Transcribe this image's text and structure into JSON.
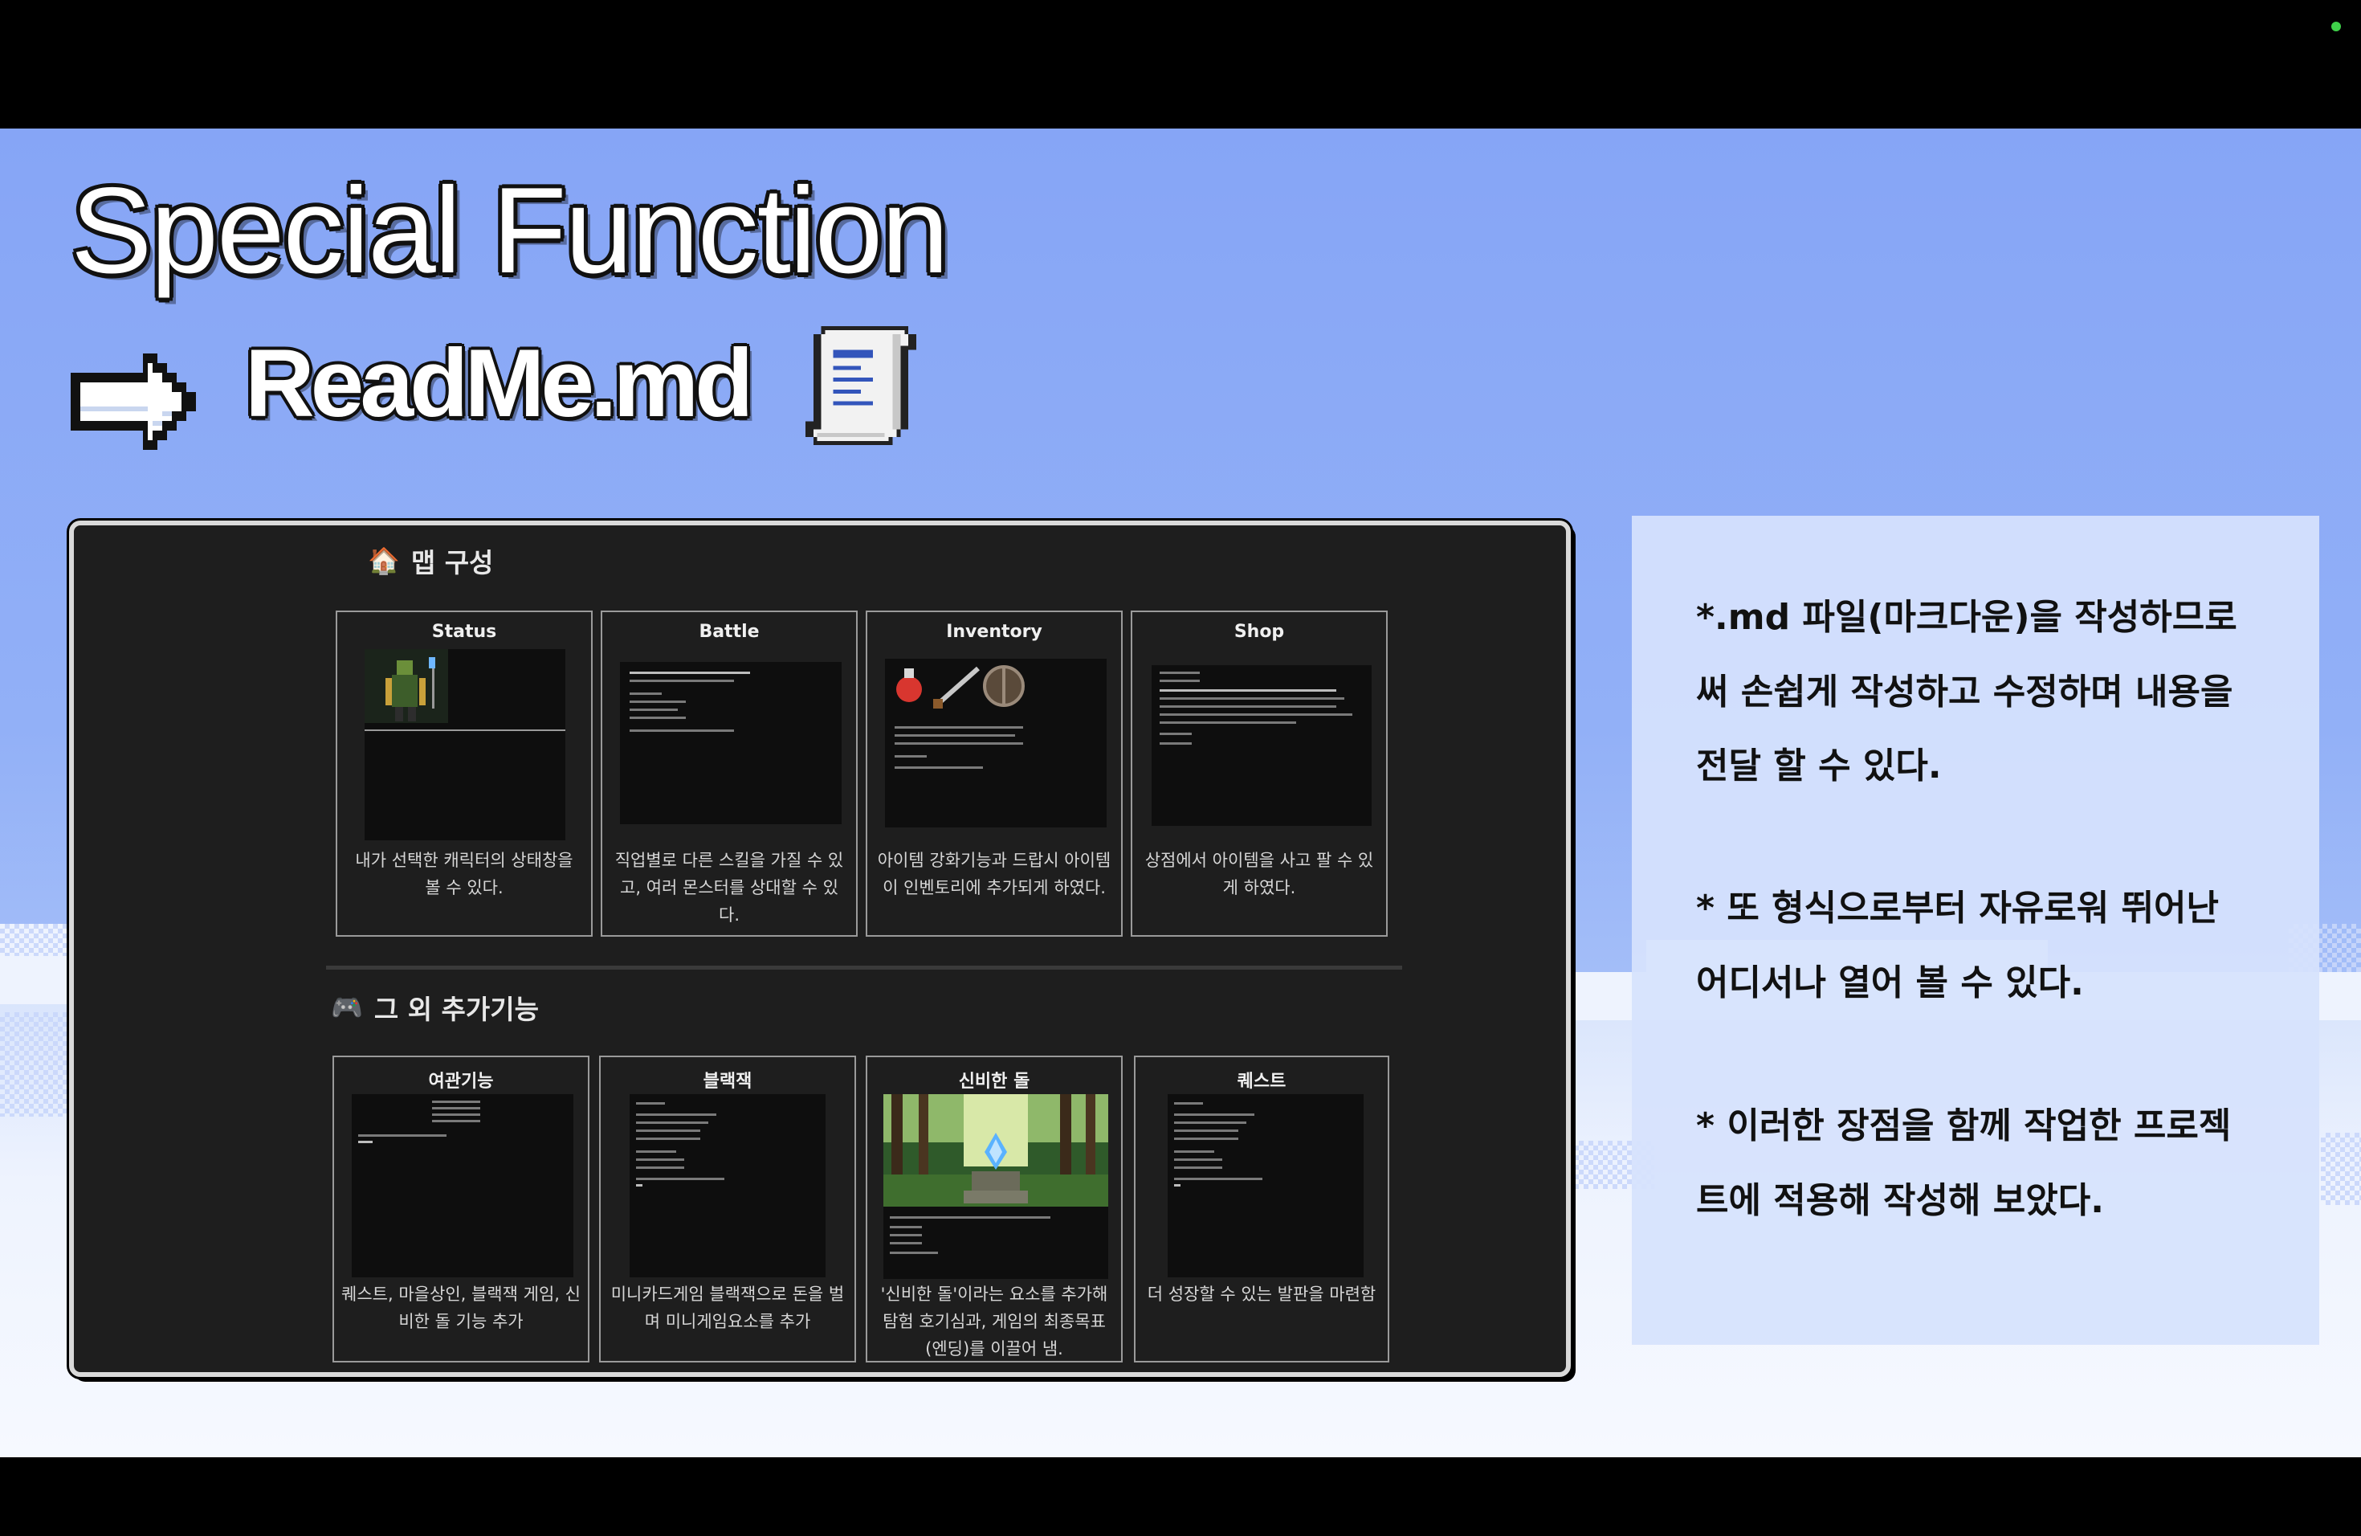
{
  "slide": {
    "title": "Special Function",
    "subtitle": "ReadMe.md",
    "icons": {
      "arrow": "pixel-arrow-right-icon",
      "document": "scroll-document-icon"
    }
  },
  "map_section": {
    "heading": "맵 구성",
    "icon": "house-emoji-icon",
    "cards": [
      {
        "title": "Status",
        "desc_lines": [
          "내가 선택한 캐릭터의 상태창을",
          "볼 수 있다."
        ]
      },
      {
        "title": "Battle",
        "desc_lines": [
          "직업별로 다른 스킬을 가질 수 있",
          "고, 여러 몬스터를 상대할 수 있",
          "다."
        ]
      },
      {
        "title": "Inventory",
        "desc_lines": [
          "아이템 강화기능과 드랍시 아이템",
          "이 인벤토리에 추가되게 하였다."
        ]
      },
      {
        "title": "Shop",
        "desc_lines": [
          "상점에서 아이템을 사고 팔 수 있",
          "게 하였다."
        ]
      }
    ]
  },
  "extra_section": {
    "heading": "그 외 추가기능",
    "icon": "gamepad-emoji-icon",
    "cards": [
      {
        "title": "여관기능",
        "desc_lines": [
          "퀘스트, 마을상인, 블랙잭 게임, 신",
          "비한 돌 기능 추가"
        ]
      },
      {
        "title": "블랙잭",
        "desc_lines": [
          "미니카드게임 블랙잭으로 돈을 벌",
          "며 미니게임요소를 추가"
        ]
      },
      {
        "title": "신비한 돌",
        "desc_lines": [
          "'신비한 돌'이라는 요소를 추가해",
          "탐험 호기심과, 게임의 최종목표",
          "(엔딩)를 이끌어 냄."
        ]
      },
      {
        "title": "퀘스트",
        "desc_lines": [
          "더 성장할 수 있는 발판을 마련함"
        ]
      }
    ]
  },
  "side_panel": {
    "lines": [
      "*.md 파일(마크다운)을 작성하므로",
      "써 손쉽게 작성하고 수정하며 내용을",
      "전달 할 수 있다.",
      "* 또 형식으로부터 자유로워 뛰어난",
      "어디서나 열어 볼 수 있다.",
      "* 이러한 장점을 함께 작업한 프로젝",
      "트에 적용해 작성해 보았다."
    ]
  },
  "colors": {
    "sky": "#86a5f6",
    "panel_dark": "#1e1e1e",
    "side_panel": "#d6e2fd",
    "rec_indicator": "#3fd14a"
  }
}
